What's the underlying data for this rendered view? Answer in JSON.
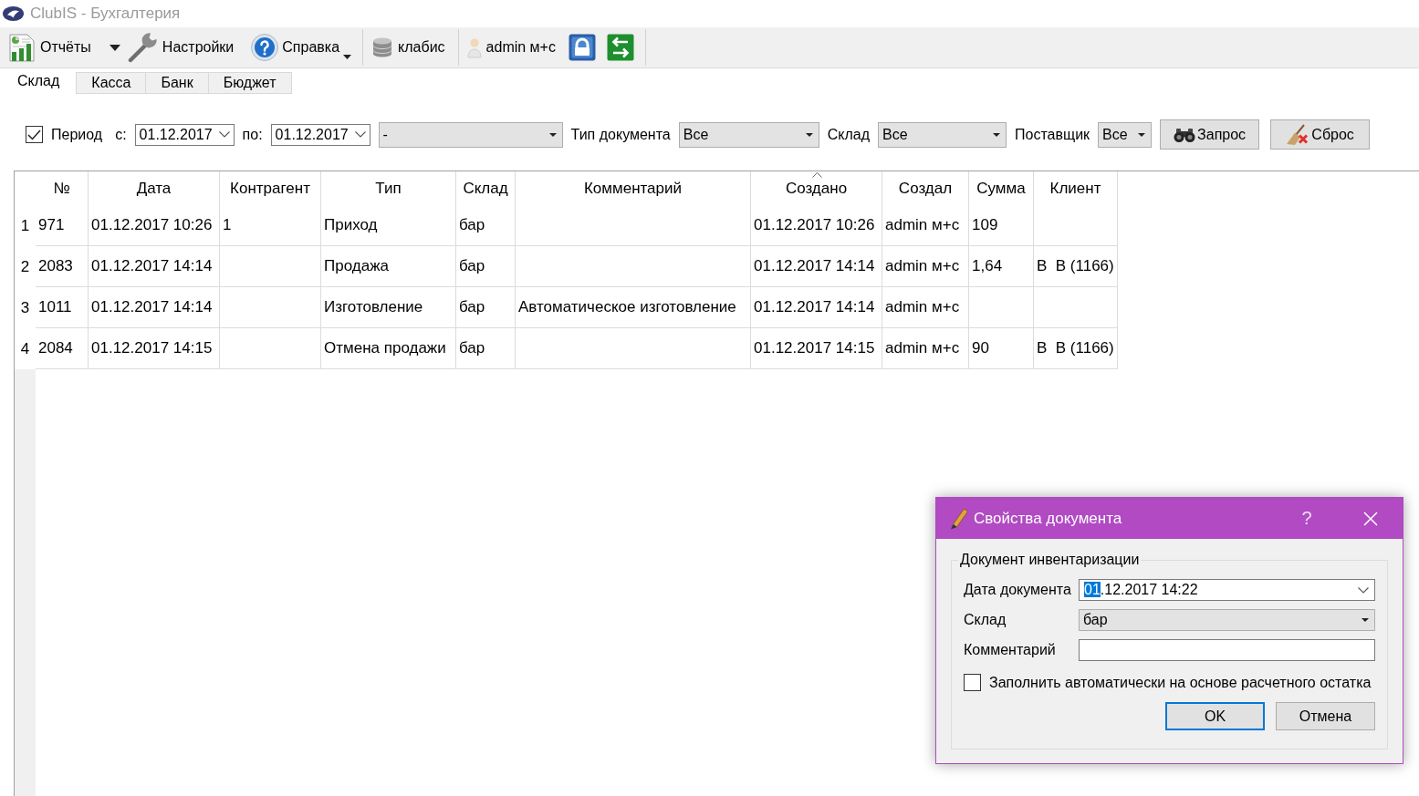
{
  "window": {
    "title": "ClubIS - Бухгалтерия"
  },
  "toolbar": [
    {
      "kind": "split",
      "label": "Отчёты"
    },
    {
      "kind": "button",
      "label": "Настройки"
    },
    {
      "kind": "menu",
      "label": "Справка"
    },
    {
      "kind": "separator"
    },
    {
      "kind": "button",
      "label": "клабис"
    },
    {
      "kind": "separator"
    },
    {
      "kind": "button",
      "label": "admin м+с"
    },
    {
      "kind": "icon"
    },
    {
      "kind": "icon"
    },
    {
      "kind": "separator"
    }
  ],
  "tabs": [
    {
      "label": "Склад",
      "selected": true
    },
    {
      "label": "Касса",
      "selected": false
    },
    {
      "label": "Банк",
      "selected": false
    },
    {
      "label": "Бюджет",
      "selected": false
    }
  ],
  "filter_bar": [
    {
      "kind": "checkbox",
      "label": "Период",
      "checked": true
    },
    {
      "kind": "label",
      "text": "с:"
    },
    {
      "kind": "date",
      "value": "01.12.2017"
    },
    {
      "kind": "label",
      "text": "по:"
    },
    {
      "kind": "date",
      "value": "01.12.2017"
    },
    {
      "kind": "combo",
      "value": "-"
    },
    {
      "kind": "label",
      "text": "Тип документа"
    },
    {
      "kind": "combo",
      "value": "Все"
    },
    {
      "kind": "label",
      "text": "Склад"
    },
    {
      "kind": "combo",
      "value": "Все"
    },
    {
      "kind": "label",
      "text": "Поставщик"
    },
    {
      "kind": "combo",
      "value": "Все"
    },
    {
      "kind": "button",
      "label": "Запрос"
    },
    {
      "kind": "button",
      "label": "Сброс"
    }
  ],
  "table": {
    "columns": [
      {
        "label": "№",
        "sorted": false
      },
      {
        "label": "Дата",
        "sorted": false
      },
      {
        "label": "Контрагент",
        "sorted": false
      },
      {
        "label": "Тип",
        "sorted": false
      },
      {
        "label": "Склад",
        "sorted": false
      },
      {
        "label": "Комментарий",
        "sorted": false
      },
      {
        "label": "Создано",
        "sorted": true
      },
      {
        "label": "Создал",
        "sorted": false
      },
      {
        "label": "Сумма",
        "sorted": false
      },
      {
        "label": "Клиент",
        "sorted": false
      }
    ],
    "rows": [
      {
        "number": "1",
        "cells": [
          "971",
          "01.12.2017 10:26",
          "1",
          "Приход",
          "бар",
          null,
          "01.12.2017 10:26",
          "admin м+с",
          "109",
          null
        ]
      },
      {
        "number": "2",
        "cells": [
          "2083",
          "01.12.2017 14:14",
          null,
          "Продажа",
          "бар",
          null,
          "01.12.2017 14:14",
          "admin м+с",
          "1,64",
          "В  В (1166)"
        ]
      },
      {
        "number": "3",
        "cells": [
          "1011",
          "01.12.2017 14:14",
          null,
          "Изготовление",
          "бар",
          "Автоматическое изготовление",
          "01.12.2017 14:14",
          "admin м+с",
          null,
          null
        ]
      },
      {
        "number": "4",
        "cells": [
          "2084",
          "01.12.2017 14:15",
          null,
          "Отмена продажи",
          "бар",
          null,
          "01.12.2017 14:15",
          "admin м+с",
          "90",
          "В  В (1166)"
        ]
      }
    ]
  },
  "dialog": {
    "title": "Свойства документа",
    "help_button": "?",
    "group": "Документ инвентаризации",
    "fields": [
      {
        "kind": "date",
        "label": "Дата документа",
        "value_parts": [
          {
            "text": "01",
            "selected": true
          },
          {
            "text": ".12.2017 14:22",
            "selected": false
          }
        ]
      },
      {
        "kind": "combo",
        "label": "Склад",
        "value": "бар"
      },
      {
        "kind": "text",
        "label": "Комментарий"
      },
      {
        "kind": "checkbox",
        "label": "Заполнить автоматически на основе расчетного остатка",
        "checked": false
      }
    ],
    "buttons": [
      {
        "label": "OK",
        "default": true
      },
      {
        "label": "Отмена",
        "default": false
      }
    ]
  }
}
